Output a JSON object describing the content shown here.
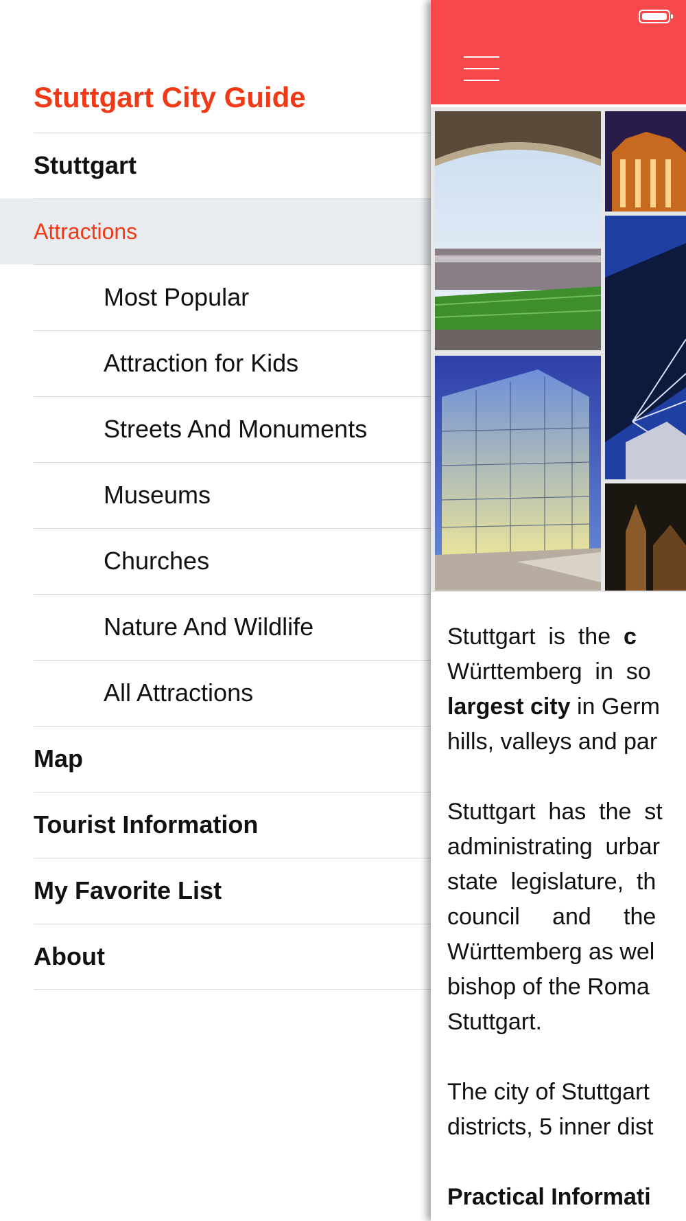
{
  "drawer": {
    "title": "Stuttgart City Guide",
    "items": [
      {
        "label": "Stuttgart",
        "level": "top"
      },
      {
        "label": "Attractions",
        "level": "active"
      },
      {
        "label": "Most Popular",
        "level": "sub"
      },
      {
        "label": "Attraction for Kids",
        "level": "sub"
      },
      {
        "label": "Streets And Monuments",
        "level": "sub"
      },
      {
        "label": "Museums",
        "level": "sub"
      },
      {
        "label": "Churches",
        "level": "sub"
      },
      {
        "label": "Nature And Wildlife",
        "level": "sub"
      },
      {
        "label": "All Attractions",
        "level": "sub"
      },
      {
        "label": "Map",
        "level": "top"
      },
      {
        "label": "Tourist Information",
        "level": "top"
      },
      {
        "label": "My Favorite List",
        "level": "top"
      },
      {
        "label": "About",
        "level": "top"
      }
    ]
  },
  "header": {
    "menu_icon": "hamburger-menu-icon",
    "battery_icon": "battery-icon",
    "color": "#f7494b"
  },
  "content": {
    "lines": [
      {
        "parts": [
          {
            "t": "Stuttgart  is  the  "
          },
          {
            "t": "c",
            "b": true
          }
        ]
      },
      {
        "parts": [
          {
            "t": "Württemberg  in  so"
          }
        ]
      },
      {
        "parts": [
          {
            "t": "largest city",
            "b": true
          },
          {
            "t": " in Germ"
          }
        ]
      },
      {
        "parts": [
          {
            "t": "hills, valleys and par"
          }
        ]
      },
      {
        "gap": true
      },
      {
        "parts": [
          {
            "t": "Stuttgart  has  the  st"
          }
        ]
      },
      {
        "parts": [
          {
            "t": "administrating  urbar"
          }
        ]
      },
      {
        "parts": [
          {
            "t": "state  legislature,  th"
          }
        ]
      },
      {
        "parts": [
          {
            "t": "council     and     the"
          }
        ]
      },
      {
        "parts": [
          {
            "t": "Württemberg as wel"
          }
        ]
      },
      {
        "parts": [
          {
            "t": "bishop of the Roma"
          }
        ]
      },
      {
        "parts": [
          {
            "t": "Stuttgart."
          }
        ]
      },
      {
        "gap": true
      },
      {
        "parts": [
          {
            "t": "The city of Stuttgart"
          }
        ]
      },
      {
        "parts": [
          {
            "t": "districts, 5 inner dist"
          }
        ]
      },
      {
        "gap": true
      },
      {
        "parts": [
          {
            "t": "Practical Informati",
            "b": true
          }
        ]
      }
    ]
  },
  "accent_color": "#f03a17"
}
